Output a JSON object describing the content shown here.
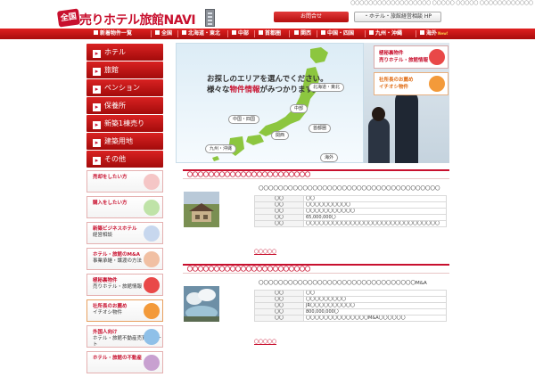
{
  "topline": "〇〇〇〇〇〇〇〇〇〇〇〇〇〇〇〇〇〇 〇〇〇〇〇 〇〇〇〇〇 〇〇〇〇〇〇〇〇〇〇〇〇",
  "logo": {
    "badge": "全国",
    "name": "売りホテル旅館NAVI"
  },
  "header": {
    "contact_label": "お問合せ",
    "mgmt_label": "・ホテル・旅館経営相談 HP"
  },
  "nav": [
    {
      "label": "新着物件一覧"
    },
    {
      "label": "全国"
    },
    {
      "label": "北海道・東北"
    },
    {
      "label": "中部"
    },
    {
      "label": "首都圏"
    },
    {
      "label": "関西"
    },
    {
      "label": "中国・四国"
    },
    {
      "label": "九州・沖縄"
    },
    {
      "label": "海外",
      "badge": "New!"
    }
  ],
  "sidenav": [
    {
      "label": "ホテル"
    },
    {
      "label": "旅館"
    },
    {
      "label": "ペンション"
    },
    {
      "label": "保養所"
    },
    {
      "label": "新築1棟売り"
    },
    {
      "label": "建築用地"
    },
    {
      "label": "その他"
    }
  ],
  "sidebanners": [
    {
      "line1": "売却をしたい方",
      "line2": "",
      "icon_color": "#f5c6c6",
      "highlight": false
    },
    {
      "line1": "購入をしたい方",
      "line2": "",
      "icon_color": "#bfe3a8",
      "highlight": false
    },
    {
      "line1": "新築ビジネスホテル",
      "line2": "経営相談",
      "icon_color": "#c7d7ee",
      "highlight": false
    },
    {
      "line1": "ホテル・旅館のM&A",
      "line2": "事業承継・譲渡の方法",
      "icon_color": "#f1c0a3",
      "highlight": false
    },
    {
      "line1": "極秘裏物件",
      "line2": "売りホテル・旅館情報",
      "icon_color": "#e94848",
      "highlight": false
    },
    {
      "line1": "社所長のお薦め",
      "line2": "イチオシ物件",
      "icon_color": "#f39a3a",
      "highlight": true
    },
    {
      "line1": "外国人向け",
      "line2": "ホテル・旅館不動産売買サポート",
      "icon_color": "#8fc0e8",
      "highlight": false
    },
    {
      "line1": "ホテル・旅館の不動産",
      "line2": "",
      "icon_color": "#c8a0d0",
      "highlight": false
    }
  ],
  "hero": {
    "title_line1": "お探しのエリアを選んでください。",
    "title_line2_pre": "様々な",
    "title_line2_em": "物件情報",
    "title_line2_post": "がみつかります。",
    "regions": [
      "北海道・東北",
      "中部",
      "中国・四国",
      "首都圏",
      "関西",
      "九州・沖縄",
      "海外"
    ]
  },
  "herobanners": [
    {
      "line1": "極秘裏物件",
      "line2": "売りホテル・旅館情報",
      "icon_color": "#e94848",
      "orange": false
    },
    {
      "line1": "社所長のお薦め",
      "line2": "イチオシ物件",
      "icon_color": "#f39a3a",
      "orange": true
    }
  ],
  "listings": [
    {
      "heading": "〇〇〇〇〇〇〇〇〇〇〇〇〇〇〇〇〇〇〇〇〇〇〇",
      "subtitle": "〇〇〇〇〇〇〇〇〇〇〇〇〇〇〇〇〇〇〇〇〇〇〇〇〇〇〇〇〇〇〇〇〇〇〇〇〇",
      "rows": [
        {
          "k": "〇〇",
          "v": "〇〇"
        },
        {
          "k": "〇〇",
          "v": "〇〇〇〇〇〇〇〇〇〇"
        },
        {
          "k": "〇〇",
          "v": "〇〇〇〇〇〇〇〇〇〇〇"
        },
        {
          "k": "〇〇",
          "v": "65,000,000〇"
        },
        {
          "k": "〇〇",
          "v": "〇〇〇〇〇〇〇〇〇〇〇〇〇〇〇〇〇〇〇〇〇〇〇〇〇〇〇〇〇〇"
        }
      ],
      "more": "〇〇〇〇〇"
    },
    {
      "heading": "〇〇〇〇〇〇〇〇〇〇〇〇〇〇〇〇〇〇〇〇〇〇〇",
      "subtitle": "〇〇〇〇〇〇〇〇〇〇〇〇〇〇〇〇〇〇〇〇〇〇〇〇〇〇〇〇〇〇〇〇M&A",
      "rows": [
        {
          "k": "〇〇",
          "v": "〇〇"
        },
        {
          "k": "〇〇",
          "v": "〇〇〇〇〇〇〇〇〇"
        },
        {
          "k": "〇〇",
          "v": "JR〇〇〇〇〇〇〇〇〇〇"
        },
        {
          "k": "〇〇",
          "v": "800,000,000〇"
        },
        {
          "k": "〇〇",
          "v": "〇〇〇〇〇〇〇〇〇〇〇〇〇〇M&A〇〇〇〇〇〇"
        }
      ],
      "more": "〇〇〇〇〇"
    }
  ],
  "colors": {
    "brand_red": "#c8102e",
    "accent_orange": "#e06a10",
    "map_green": "#8cc63f"
  }
}
